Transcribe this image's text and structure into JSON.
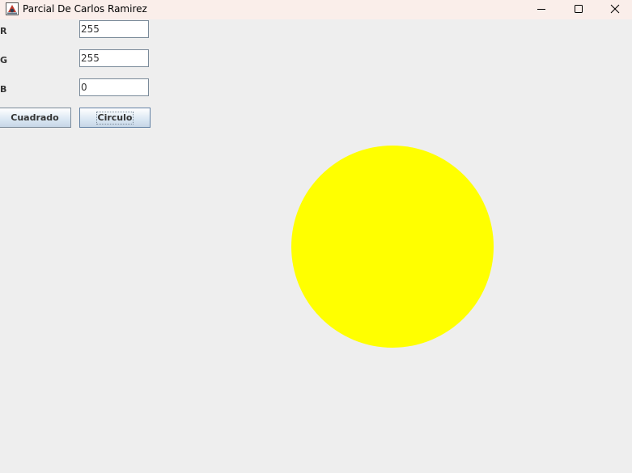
{
  "window": {
    "title": "Parcial De Carlos Ramirez"
  },
  "form": {
    "r_label": "R",
    "r_value": "255",
    "g_label": "G",
    "g_value": "255",
    "b_label": "B",
    "b_value": "0"
  },
  "buttons": {
    "square_label": "Cuadrado",
    "circle_label": "Circulo"
  },
  "drawing": {
    "shape": "circle",
    "fill_color": "#ffff00"
  },
  "colors": {
    "background": "#eeeeee",
    "titlebar": "#faeeea"
  }
}
